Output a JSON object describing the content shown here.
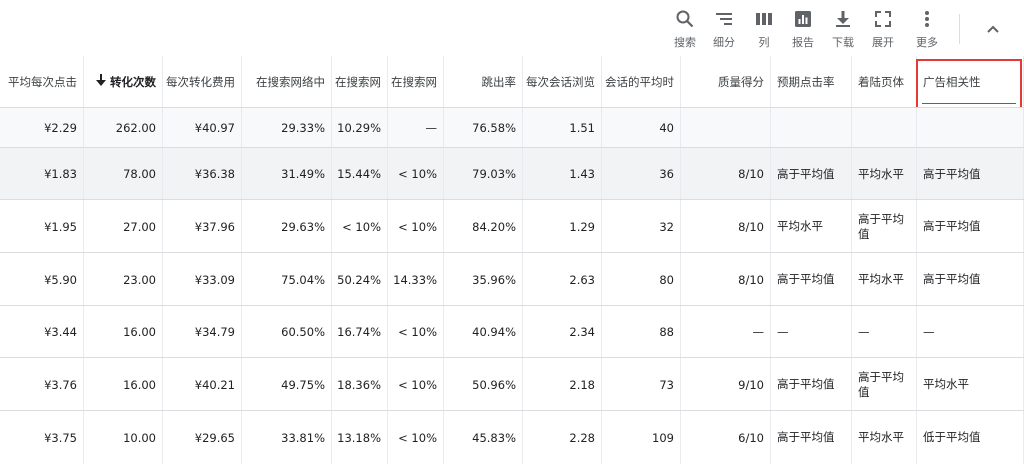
{
  "toolbar": {
    "search_label": "搜索",
    "segment_label": "细分",
    "columns_label": "列",
    "reports_label": "报告",
    "download_label": "下载",
    "expand_label": "展开",
    "more_label": "更多"
  },
  "table": {
    "headers": [
      "平均每次点击",
      "转化次数",
      "每次转化费用",
      "在搜索网络中",
      "在搜索网",
      "在搜索网",
      "跳出率",
      "每次会话浏览",
      "会话的平均时",
      "质量得分",
      "预期点击率",
      "着陆页体",
      "广告相关性"
    ],
    "rows": [
      [
        "¥2.29",
        "262.00",
        "¥40.97",
        "29.33%",
        "10.29%",
        "—",
        "76.58%",
        "1.51",
        "40",
        "",
        "",
        "",
        ""
      ],
      [
        "¥1.83",
        "78.00",
        "¥36.38",
        "31.49%",
        "15.44%",
        "< 10%",
        "79.03%",
        "1.43",
        "36",
        "8/10",
        "高于平均值",
        "平均水平",
        "高于平均值"
      ],
      [
        "¥1.95",
        "27.00",
        "¥37.96",
        "29.63%",
        "< 10%",
        "< 10%",
        "84.20%",
        "1.29",
        "32",
        "8/10",
        "平均水平",
        "高于平均值",
        "高于平均值"
      ],
      [
        "¥5.90",
        "23.00",
        "¥33.09",
        "75.04%",
        "50.24%",
        "14.33%",
        "35.96%",
        "2.63",
        "80",
        "8/10",
        "高于平均值",
        "平均水平",
        "高于平均值"
      ],
      [
        "¥3.44",
        "16.00",
        "¥34.79",
        "60.50%",
        "16.74%",
        "< 10%",
        "40.94%",
        "2.34",
        "88",
        "—",
        "—",
        "—",
        "—"
      ],
      [
        "¥3.76",
        "16.00",
        "¥40.21",
        "49.75%",
        "18.36%",
        "< 10%",
        "50.96%",
        "2.18",
        "73",
        "9/10",
        "高于平均值",
        "高于平均值",
        "平均水平"
      ],
      [
        "¥3.75",
        "10.00",
        "¥29.65",
        "33.81%",
        "13.18%",
        "< 10%",
        "45.83%",
        "2.28",
        "109",
        "6/10",
        "高于平均值",
        "平均水平",
        "低于平均值"
      ]
    ]
  },
  "colors": {
    "highlight": "#e53935",
    "total_row_bg": "#f8f9fa",
    "hover_row_bg": "#f1f3f4"
  }
}
